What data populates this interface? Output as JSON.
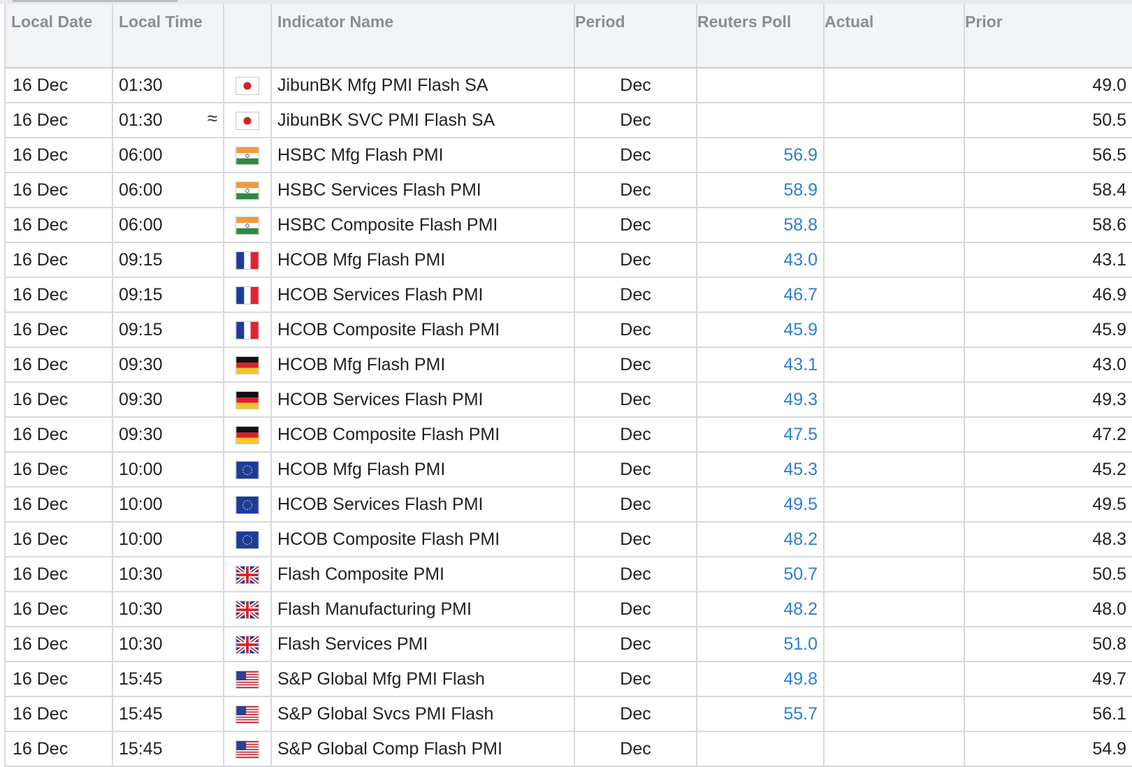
{
  "columns": {
    "date": "Local Date",
    "time": "Local Time",
    "flag": "",
    "name": "Indicator Name",
    "period": "Period",
    "poll": "Reuters Poll",
    "actual": "Actual",
    "prior": "Prior"
  },
  "colors": {
    "poll_text": "#2b7fd6",
    "header_text": "#8a8d93",
    "grid": "#d7d9de"
  },
  "rows": [
    {
      "date": "16 Dec",
      "time": "01:30",
      "approx": "",
      "country": "japan-flag-icon",
      "name": "JibunBK Mfg PMI Flash SA",
      "period": "Dec",
      "poll": "",
      "actual": "",
      "prior": "49.0"
    },
    {
      "date": "16 Dec",
      "time": "01:30",
      "approx": "≈",
      "country": "japan-flag-icon",
      "name": "JibunBK SVC PMI Flash SA",
      "period": "Dec",
      "poll": "",
      "actual": "",
      "prior": "50.5"
    },
    {
      "date": "16 Dec",
      "time": "06:00",
      "approx": "",
      "country": "india-flag-icon",
      "name": "HSBC Mfg Flash PMI",
      "period": "Dec",
      "poll": "56.9",
      "actual": "",
      "prior": "56.5"
    },
    {
      "date": "16 Dec",
      "time": "06:00",
      "approx": "",
      "country": "india-flag-icon",
      "name": "HSBC Services Flash PMI",
      "period": "Dec",
      "poll": "58.9",
      "actual": "",
      "prior": "58.4"
    },
    {
      "date": "16 Dec",
      "time": "06:00",
      "approx": "",
      "country": "india-flag-icon",
      "name": "HSBC Composite Flash PMI",
      "period": "Dec",
      "poll": "58.8",
      "actual": "",
      "prior": "58.6"
    },
    {
      "date": "16 Dec",
      "time": "09:15",
      "approx": "",
      "country": "france-flag-icon",
      "name": "HCOB Mfg Flash PMI",
      "period": "Dec",
      "poll": "43.0",
      "actual": "",
      "prior": "43.1"
    },
    {
      "date": "16 Dec",
      "time": "09:15",
      "approx": "",
      "country": "france-flag-icon",
      "name": "HCOB Services Flash PMI",
      "period": "Dec",
      "poll": "46.7",
      "actual": "",
      "prior": "46.9"
    },
    {
      "date": "16 Dec",
      "time": "09:15",
      "approx": "",
      "country": "france-flag-icon",
      "name": "HCOB Composite Flash PMI",
      "period": "Dec",
      "poll": "45.9",
      "actual": "",
      "prior": "45.9"
    },
    {
      "date": "16 Dec",
      "time": "09:30",
      "approx": "",
      "country": "germany-flag-icon",
      "name": "HCOB Mfg Flash PMI",
      "period": "Dec",
      "poll": "43.1",
      "actual": "",
      "prior": "43.0"
    },
    {
      "date": "16 Dec",
      "time": "09:30",
      "approx": "",
      "country": "germany-flag-icon",
      "name": "HCOB Services Flash PMI",
      "period": "Dec",
      "poll": "49.3",
      "actual": "",
      "prior": "49.3"
    },
    {
      "date": "16 Dec",
      "time": "09:30",
      "approx": "",
      "country": "germany-flag-icon",
      "name": "HCOB Composite Flash PMI",
      "period": "Dec",
      "poll": "47.5",
      "actual": "",
      "prior": "47.2"
    },
    {
      "date": "16 Dec",
      "time": "10:00",
      "approx": "",
      "country": "eu-flag-icon",
      "name": "HCOB Mfg Flash PMI",
      "period": "Dec",
      "poll": "45.3",
      "actual": "",
      "prior": "45.2"
    },
    {
      "date": "16 Dec",
      "time": "10:00",
      "approx": "",
      "country": "eu-flag-icon",
      "name": "HCOB Services Flash PMI",
      "period": "Dec",
      "poll": "49.5",
      "actual": "",
      "prior": "49.5"
    },
    {
      "date": "16 Dec",
      "time": "10:00",
      "approx": "",
      "country": "eu-flag-icon",
      "name": "HCOB Composite Flash PMI",
      "period": "Dec",
      "poll": "48.2",
      "actual": "",
      "prior": "48.3"
    },
    {
      "date": "16 Dec",
      "time": "10:30",
      "approx": "",
      "country": "uk-flag-icon",
      "name": "Flash Composite PMI",
      "period": "Dec",
      "poll": "50.7",
      "actual": "",
      "prior": "50.5"
    },
    {
      "date": "16 Dec",
      "time": "10:30",
      "approx": "",
      "country": "uk-flag-icon",
      "name": "Flash Manufacturing PMI",
      "period": "Dec",
      "poll": "48.2",
      "actual": "",
      "prior": "48.0"
    },
    {
      "date": "16 Dec",
      "time": "10:30",
      "approx": "",
      "country": "uk-flag-icon",
      "name": "Flash Services PMI",
      "period": "Dec",
      "poll": "51.0",
      "actual": "",
      "prior": "50.8"
    },
    {
      "date": "16 Dec",
      "time": "15:45",
      "approx": "",
      "country": "us-flag-icon",
      "name": "S&P Global Mfg PMI Flash",
      "period": "Dec",
      "poll": "49.8",
      "actual": "",
      "prior": "49.7"
    },
    {
      "date": "16 Dec",
      "time": "15:45",
      "approx": "",
      "country": "us-flag-icon",
      "name": "S&P Global Svcs PMI Flash",
      "period": "Dec",
      "poll": "55.7",
      "actual": "",
      "prior": "56.1"
    },
    {
      "date": "16 Dec",
      "time": "15:45",
      "approx": "",
      "country": "us-flag-icon",
      "name": "S&P Global Comp Flash PMI",
      "period": "Dec",
      "poll": "",
      "actual": "",
      "prior": "54.9"
    }
  ]
}
